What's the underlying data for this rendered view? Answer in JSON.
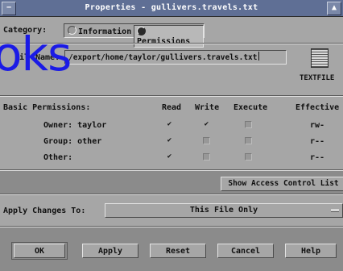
{
  "window": {
    "title": "Properties - gullivers.travels.txt"
  },
  "category": {
    "label": "Category:",
    "options": [
      "Information",
      "Permissions"
    ],
    "selected": "Permissions"
  },
  "file": {
    "name_label": "Name:",
    "name_value": "/export/home/taylor/gullivers.travels.txt",
    "type_label": "TEXTFILE",
    "overlay_prefix": "Fil"
  },
  "overlay_text": "oks",
  "permissions": {
    "heading": "Basic Permissions:",
    "columns": [
      "Read",
      "Write",
      "Execute",
      "Effective"
    ],
    "rows": [
      {
        "label": "Owner: taylor",
        "read": true,
        "write": true,
        "execute": false,
        "effective": "rw-"
      },
      {
        "label": "Group: other",
        "read": true,
        "write": false,
        "execute": false,
        "effective": "r--"
      },
      {
        "label": "Other:",
        "read": true,
        "write": false,
        "execute": false,
        "effective": "r--"
      }
    ]
  },
  "acl_button": "Show Access Control List",
  "apply": {
    "label": "Apply Changes To:",
    "value": "This File Only"
  },
  "buttons": {
    "ok": "OK",
    "apply": "Apply",
    "reset": "Reset",
    "cancel": "Cancel",
    "help": "Help"
  },
  "check_glyph": "✔"
}
